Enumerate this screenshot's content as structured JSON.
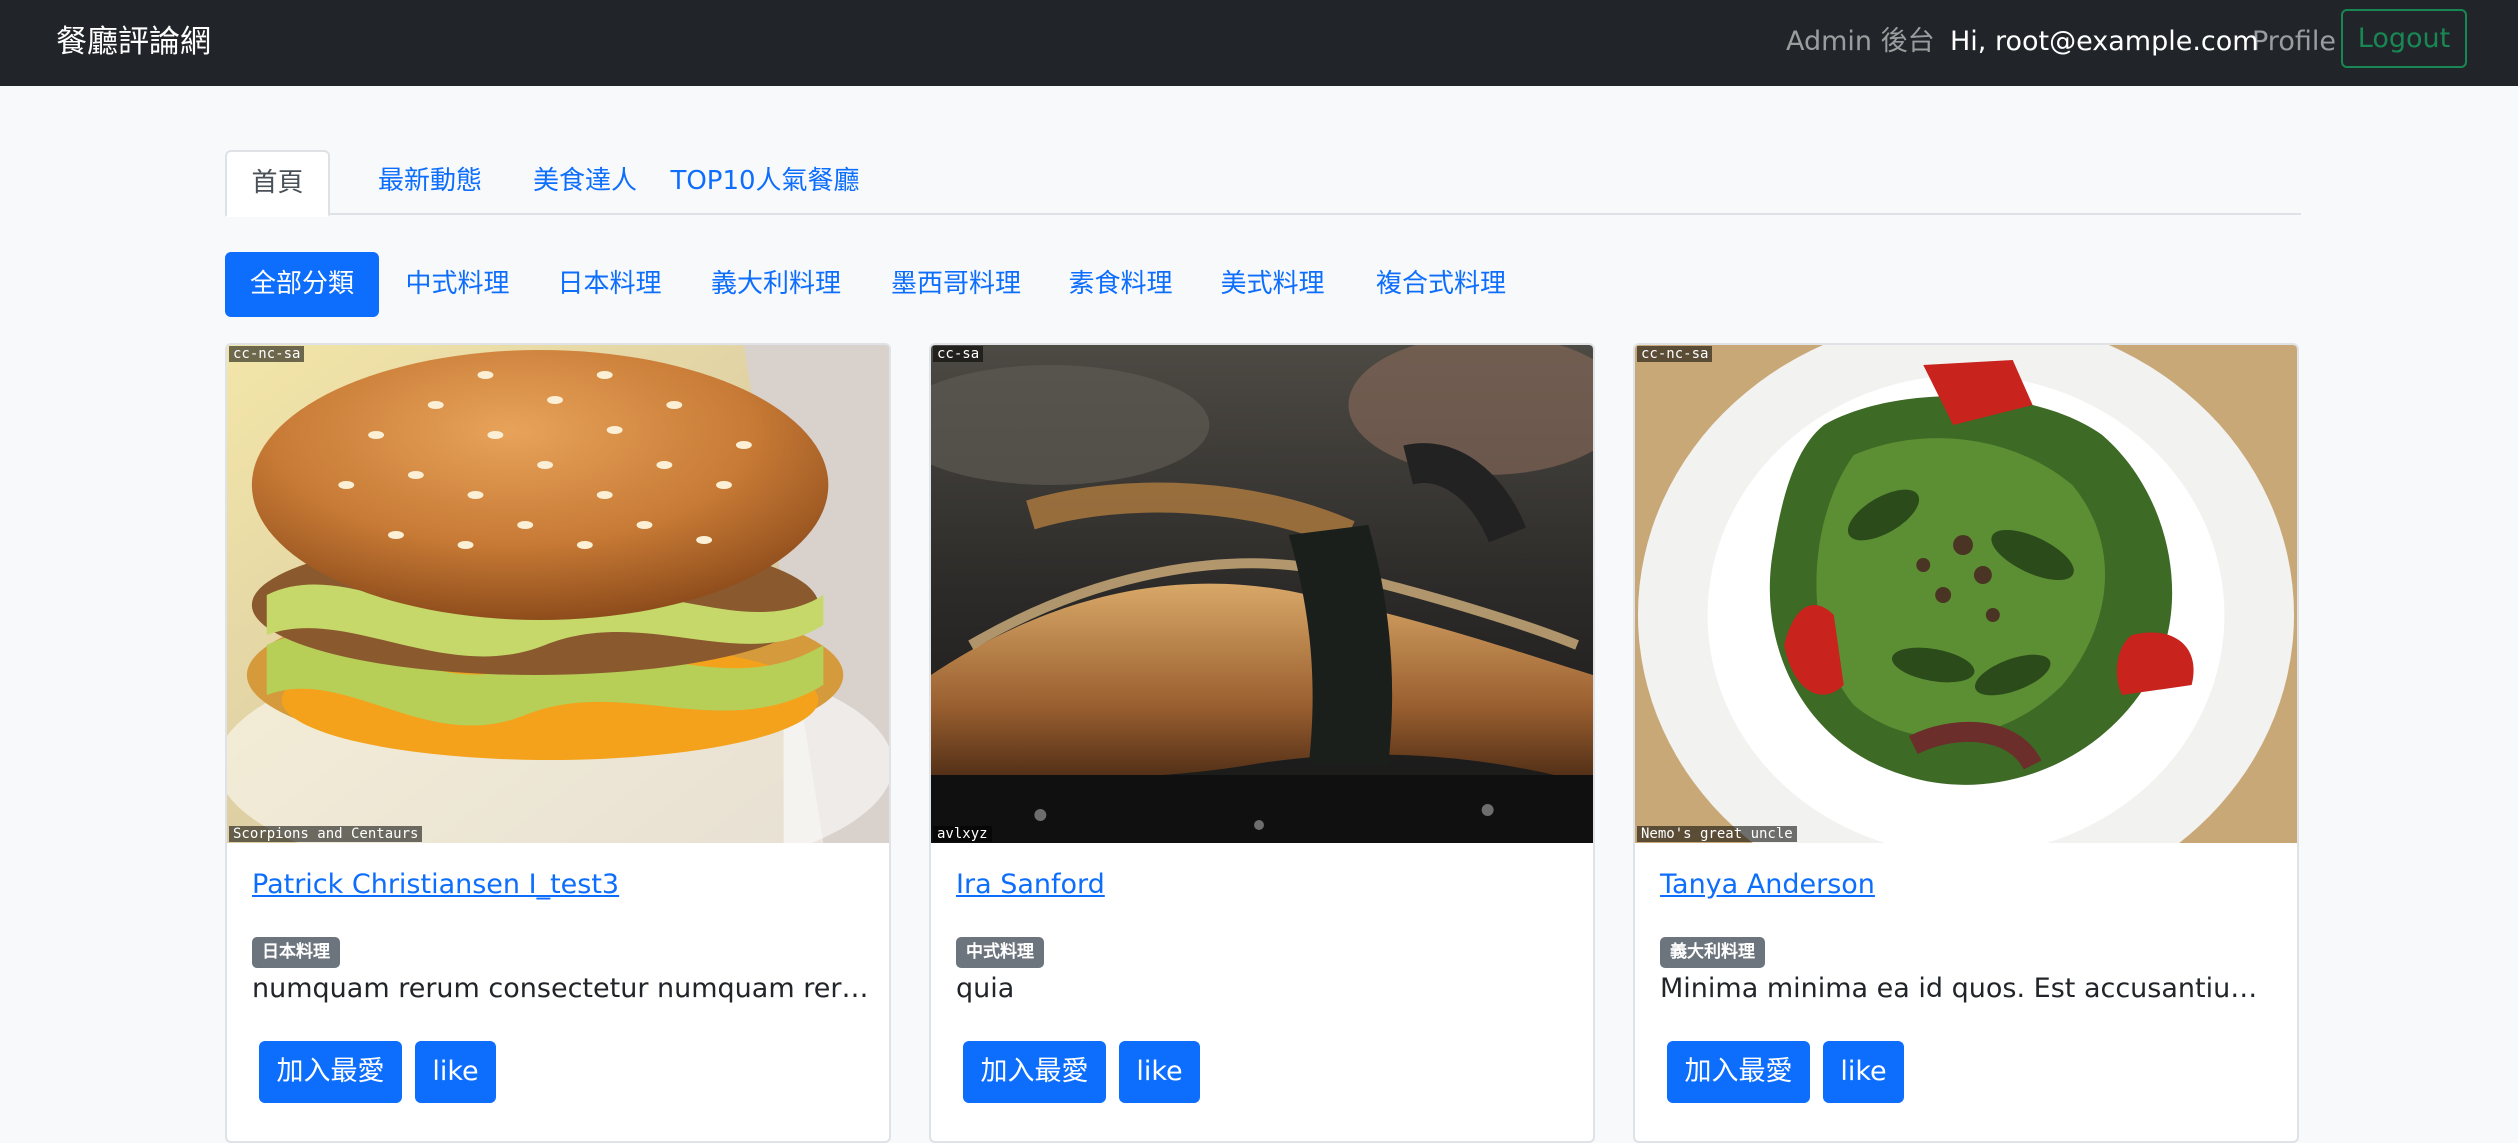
{
  "navbar": {
    "brand": "餐廳評論網",
    "admin": "Admin 後台",
    "greeting": "Hi, root@example.com",
    "profile": "Profile",
    "logout": "Logout"
  },
  "tabs": [
    {
      "label": "首頁",
      "active": true
    },
    {
      "label": "最新動態",
      "active": false
    },
    {
      "label": "美食達人",
      "active": false
    },
    {
      "label": "TOP10人氣餐廳",
      "active": false
    }
  ],
  "categories": [
    {
      "label": "全部分類",
      "active": true
    },
    {
      "label": "中式料理",
      "active": false
    },
    {
      "label": "日本料理",
      "active": false
    },
    {
      "label": "義大利料理",
      "active": false
    },
    {
      "label": "墨西哥料理",
      "active": false
    },
    {
      "label": "素食料理",
      "active": false
    },
    {
      "label": "美式料理",
      "active": false
    },
    {
      "label": "複合式料理",
      "active": false
    }
  ],
  "cards": [
    {
      "title": "Patrick Christiansen I_test3",
      "category": "日本料理",
      "description": "numquam rerum consectetur numquam rerum c...",
      "image": "burger-photo",
      "license": "cc-nc-sa",
      "credit": "Scorpions and Centaurs",
      "fav_label": "加入最愛",
      "like_label": "like"
    },
    {
      "title": "Ira Sanford",
      "category": "中式料理",
      "description": "quia",
      "image": "eel-sushi-photo",
      "license": "cc-sa",
      "credit": "avlxyz",
      "fav_label": "加入最愛",
      "like_label": "like"
    },
    {
      "title": "Tanya Anderson",
      "category": "義大利料理",
      "description": "Minima minima ea id quos. Est accusantium ulla...",
      "image": "salad-photo",
      "license": "cc-nc-sa",
      "credit": "Nemo's great uncle",
      "fav_label": "加入最愛",
      "like_label": "like"
    }
  ]
}
